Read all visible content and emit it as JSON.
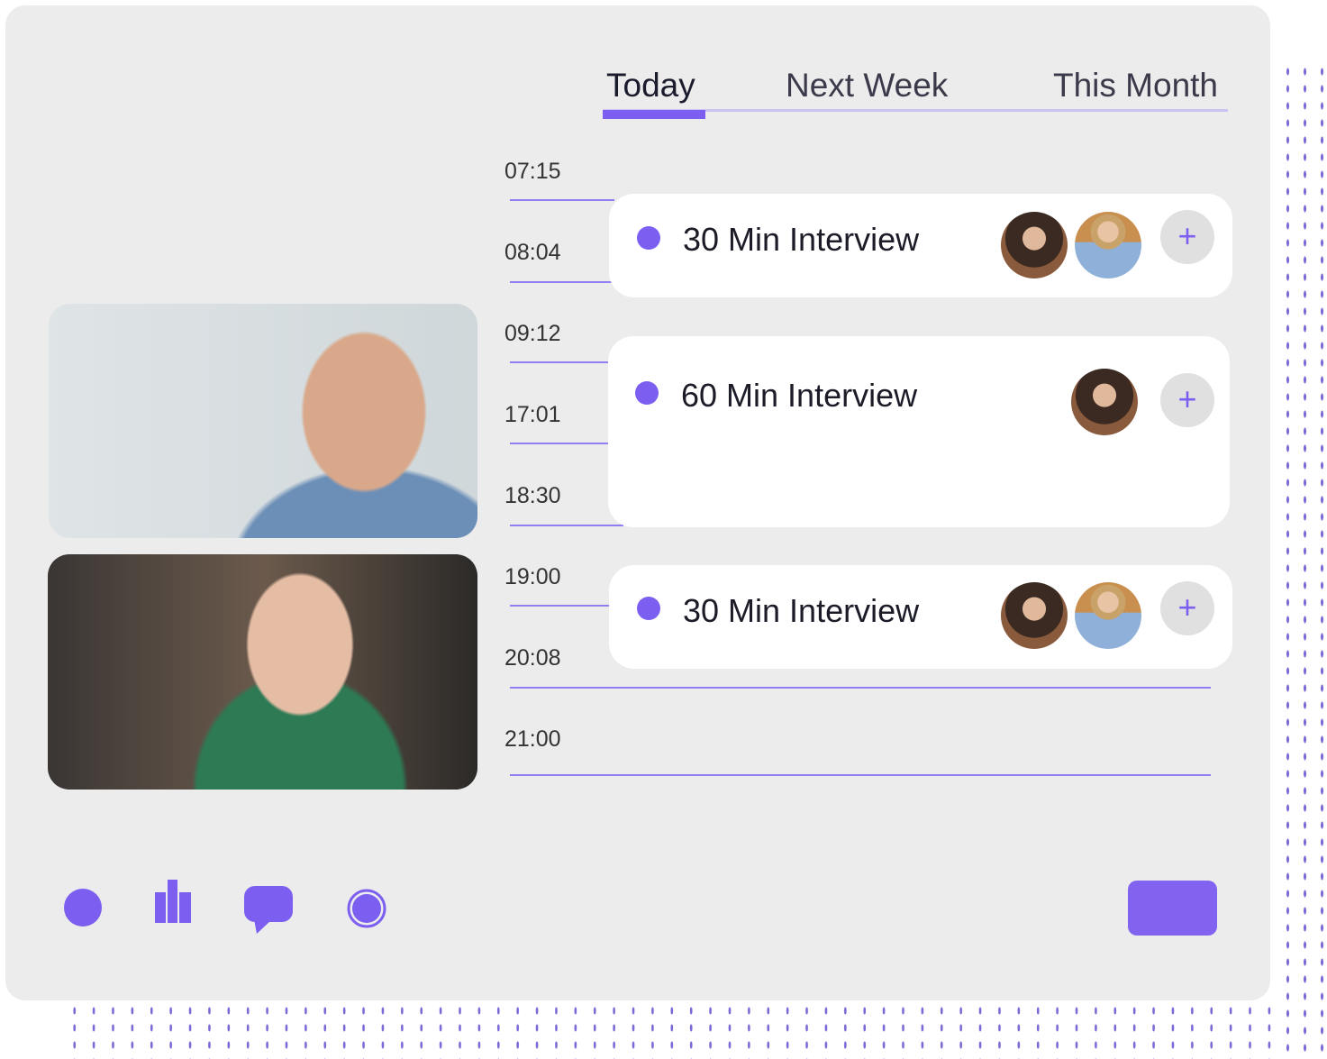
{
  "tabs": [
    {
      "label": "Today",
      "active": true
    },
    {
      "label": "Next Week",
      "active": false
    },
    {
      "label": "This Month",
      "active": false
    }
  ],
  "times": [
    "07:15",
    "08:04",
    "09:12",
    "17:01",
    "18:30",
    "19:00",
    "20:08",
    "21:00"
  ],
  "events": [
    {
      "title": "30 Min Interview",
      "participants": 2,
      "add_label": "+"
    },
    {
      "title": "60 Min Interview",
      "participants": 1,
      "add_label": "+"
    },
    {
      "title": "30 Min Interview",
      "participants": 2,
      "add_label": "+"
    }
  ],
  "toolbar": {
    "icons": [
      "mic-icon",
      "stats-icon",
      "chat-icon",
      "record-icon"
    ]
  },
  "colors": {
    "accent": "#7c5ff0",
    "card": "#ececec"
  }
}
